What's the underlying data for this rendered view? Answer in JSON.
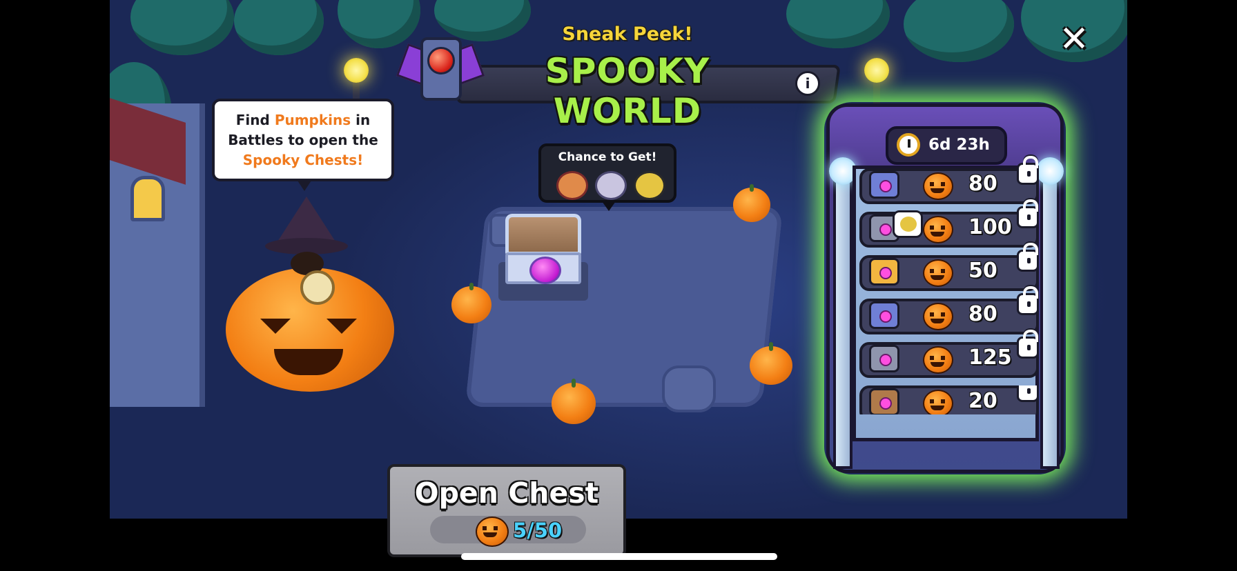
{
  "header": {
    "subtitle": "Sneak Peek!",
    "title": "SPOOKY WORLD",
    "info_icon": "info-icon",
    "info_label": "i",
    "close_icon": "close-icon",
    "close_label": "✕"
  },
  "tip_bubble": {
    "line1_prefix": "Find ",
    "line1_highlight": "Pumpkins",
    "line1_suffix": " in",
    "line2": "Battles to open the",
    "line3_highlight": "Spooky Chests!",
    "highlight_color": "#f07a1d"
  },
  "chance_popup": {
    "label": "Chance to Get!",
    "icons": [
      "brawler-cap-icon",
      "brawler-ghost-icon",
      "brawler-sombrero-icon"
    ]
  },
  "reward_track": {
    "timer_icon": "stopwatch-icon",
    "timer_text": "6d 23h",
    "rows": [
      {
        "chest": "purple-chest-icon",
        "cost": "80",
        "locked": true,
        "chest_color": "#6f7fd6"
      },
      {
        "chest": "grey-chest-icon",
        "cost": "100",
        "locked": true,
        "chest_color": "#8f95ad"
      },
      {
        "chest": "gold-chest-icon",
        "cost": "50",
        "locked": true,
        "chest_color": "#f2b640"
      },
      {
        "chest": "purple-chest-icon",
        "cost": "80",
        "locked": true,
        "chest_color": "#6f7fd6"
      },
      {
        "chest": "grey-chest-icon",
        "cost": "125",
        "locked": true,
        "chest_color": "#8f95ad"
      },
      {
        "chest": "brown-chest-icon",
        "cost": "20",
        "locked": true,
        "chest_color": "#b07a4a"
      }
    ]
  },
  "open_chest": {
    "label": "Open Chest",
    "progress_text": "5/50",
    "progress_current": 5,
    "progress_total": 50,
    "currency_icon": "pumpkin-icon"
  },
  "colors": {
    "title_green": "#a8f04a",
    "subtitle_yellow": "#f6d53a",
    "progress_blue": "#4ad2ff",
    "panel_glow": "#7cf05a"
  }
}
